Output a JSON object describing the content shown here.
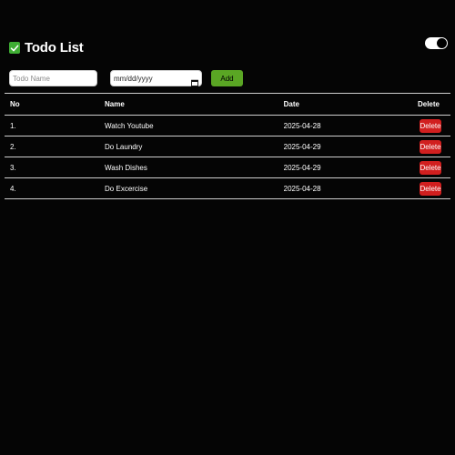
{
  "header": {
    "title": "Todo List",
    "check_icon": "check-icon",
    "accent": "#3fae34"
  },
  "theme_toggle": {
    "state": "on"
  },
  "form": {
    "name_placeholder": "Todo Name",
    "date_value": "mm/dd/yyyy",
    "add_label": "Add",
    "add_color": "#5aa624"
  },
  "table": {
    "columns": [
      "No",
      "Name",
      "Date",
      "Delete"
    ],
    "rows": [
      {
        "no": "1.",
        "name": "Watch Youtube",
        "date": "2025-04-28",
        "delete": "Delete"
      },
      {
        "no": "2.",
        "name": "Do Laundry",
        "date": "2025-04-29",
        "delete": "Delete"
      },
      {
        "no": "3.",
        "name": "Wash Dishes",
        "date": "2025-04-29",
        "delete": "Delete"
      },
      {
        "no": "4.",
        "name": "Do Excercise",
        "date": "2025-04-28",
        "delete": "Delete"
      }
    ],
    "delete_color": "#d11f1f"
  }
}
